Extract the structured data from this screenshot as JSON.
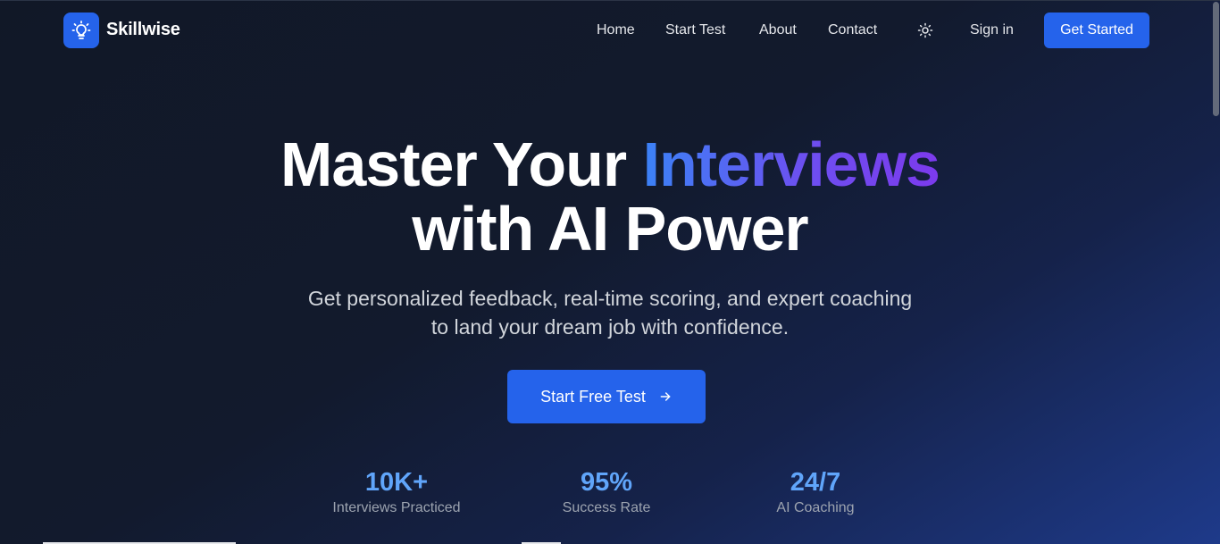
{
  "brand": {
    "name": "Skillwise",
    "logo_icon": "lightbulb-icon",
    "logo_color": "#2563eb"
  },
  "nav": {
    "links": [
      {
        "label": "Home"
      },
      {
        "label": "Start Test"
      },
      {
        "label": "About"
      },
      {
        "label": "Contact"
      }
    ],
    "theme_toggle_icon": "sun-icon",
    "sign_in": "Sign in",
    "get_started": "Get Started"
  },
  "hero": {
    "title_part1": "Master Your",
    "title_highlight": "Interviews",
    "title_line2": "with AI Power",
    "subtitle_line1": "Get personalized feedback, real-time scoring, and expert coaching",
    "subtitle_line2": "to land your dream job with confidence.",
    "cta_label": "Start Free Test",
    "cta_icon": "arrow-right-icon"
  },
  "stats": [
    {
      "value": "10K+",
      "label": "Interviews Practiced"
    },
    {
      "value": "95%",
      "label": "Success Rate"
    },
    {
      "value": "24/7",
      "label": "AI Coaching"
    }
  ],
  "colors": {
    "accent": "#2563eb",
    "stat_value": "#60a5fa",
    "gradient_start": "#3b82f6",
    "gradient_end": "#7c3aed",
    "background": "#111827"
  }
}
